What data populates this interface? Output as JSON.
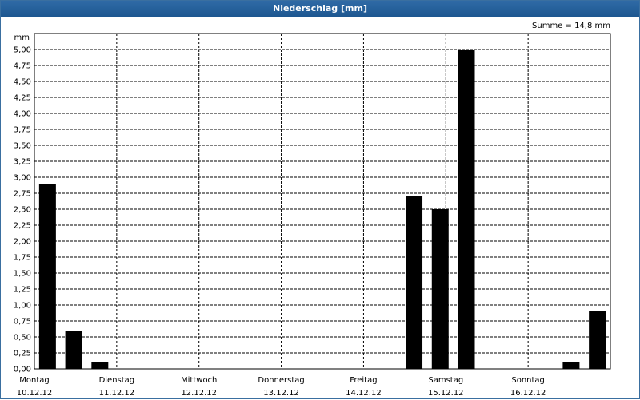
{
  "window": {
    "title": "Niederschlag [mm]"
  },
  "summary": {
    "text": "Summe = 14,8 mm"
  },
  "chart_data": {
    "type": "bar",
    "title": "Niederschlag [mm]",
    "ylabel": "mm",
    "xlabel": "",
    "ylim": [
      0,
      5.25
    ],
    "grid": true,
    "bar_color": "#000000",
    "days": [
      {
        "name": "Montag",
        "date": "10.12.12"
      },
      {
        "name": "Dienstag",
        "date": "11.12.12"
      },
      {
        "name": "Mittwoch",
        "date": "12.12.12"
      },
      {
        "name": "Donnerstag",
        "date": "13.12.12"
      },
      {
        "name": "Freitag",
        "date": "14.12.12"
      },
      {
        "name": "Samstag",
        "date": "15.12.12"
      },
      {
        "name": "Sonntag",
        "date": "16.12.12"
      }
    ],
    "values": [
      2.9,
      0.6,
      0.1,
      0,
      0,
      0,
      0,
      0,
      0,
      0,
      0,
      0,
      0,
      0,
      2.7,
      2.5,
      5.0,
      0,
      0,
      0,
      0.1,
      0.9
    ],
    "y_ticks": [
      "0,00",
      "0,25",
      "0,50",
      "0,75",
      "1,00",
      "1,25",
      "1,50",
      "1,75",
      "2,00",
      "2,25",
      "2,50",
      "2,75",
      "3,00",
      "3,25",
      "3,50",
      "3,75",
      "4,00",
      "4,25",
      "4,50",
      "4,75",
      "5,00"
    ]
  }
}
